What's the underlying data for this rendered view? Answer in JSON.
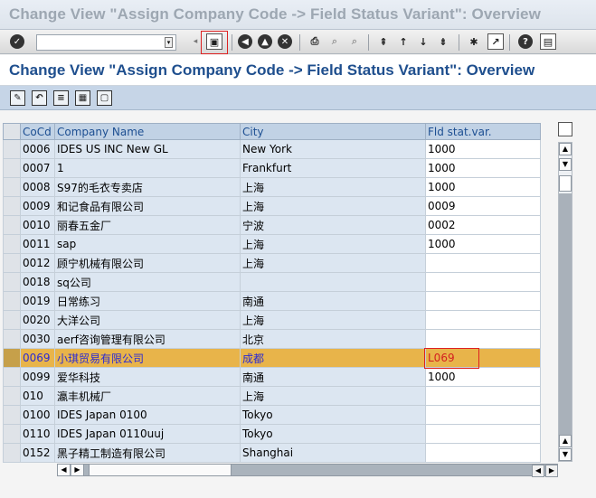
{
  "window_title": "Change View \"Assign Company Code -> Field Status Variant\": Overview",
  "screen_title": "Change View \"Assign Company Code -> Field Status Variant\": Overview",
  "toolbar": {
    "okcode_value": "",
    "icons": [
      "check-icon",
      "save-icon",
      "back-icon",
      "exit-icon",
      "cancel-icon",
      "print-icon",
      "find-icon",
      "find-next-icon",
      "first-page-icon",
      "prev-page-icon",
      "next-page-icon",
      "last-page-icon",
      "new-session-icon",
      "shortcut-icon",
      "help-icon",
      "customize-layout-icon"
    ]
  },
  "app_toolbar": {
    "icons": [
      "edit-toggle-icon",
      "undo-icon",
      "details-icon",
      "select-all-icon",
      "deselect-icon"
    ]
  },
  "table": {
    "columns": [
      "CoCd",
      "Company Name",
      "City",
      "Fld stat.var."
    ],
    "rows": [
      {
        "cocd": "0006",
        "name": "IDES US INC New GL",
        "city": "New York",
        "fsv": "1000"
      },
      {
        "cocd": "0007",
        "name": "1",
        "city": "Frankfurt",
        "fsv": "1000"
      },
      {
        "cocd": "0008",
        "name": "S97的毛衣专卖店",
        "city": "上海",
        "fsv": "1000"
      },
      {
        "cocd": "0009",
        "name": "和记食品有限公司",
        "city": "上海",
        "fsv": "0009"
      },
      {
        "cocd": "0010",
        "name": "丽春五金厂",
        "city": "宁波",
        "fsv": "0002"
      },
      {
        "cocd": "0011",
        "name": "sap",
        "city": "上海",
        "fsv": "1000"
      },
      {
        "cocd": "0012",
        "name": "顾宁机械有限公司",
        "city": "上海",
        "fsv": ""
      },
      {
        "cocd": "0018",
        "name": "sq公司",
        "city": "",
        "fsv": ""
      },
      {
        "cocd": "0019",
        "name": "日常练习",
        "city": "南通",
        "fsv": ""
      },
      {
        "cocd": "0020",
        "name": "大洋公司",
        "city": "上海",
        "fsv": ""
      },
      {
        "cocd": "0030",
        "name": "aerf咨询管理有限公司",
        "city": "北京",
        "fsv": ""
      },
      {
        "cocd": "0069",
        "name": "小琪贸易有限公司",
        "city": "成都",
        "fsv": "L069"
      },
      {
        "cocd": "0099",
        "name": "爱华科技",
        "city": "南通",
        "fsv": "1000"
      },
      {
        "cocd": "010",
        "name": "瀛丰机械厂",
        "city": "上海",
        "fsv": ""
      },
      {
        "cocd": "0100",
        "name": "IDES Japan 0100",
        "city": "Tokyo",
        "fsv": ""
      },
      {
        "cocd": "0110",
        "name": "IDES Japan 0110uuj",
        "city": "Tokyo",
        "fsv": ""
      },
      {
        "cocd": "0152",
        "name": "黑子精工制造有限公司",
        "city": "Shanghai",
        "fsv": ""
      }
    ],
    "highlighted_row": 11
  },
  "colors": {
    "title_blue": "#1f4f8e",
    "header_bg": "#c1d2e5",
    "readonly_cell": "#dce6f1",
    "highlight_row": "#e8b44a",
    "annotation_red": "#d22222"
  }
}
